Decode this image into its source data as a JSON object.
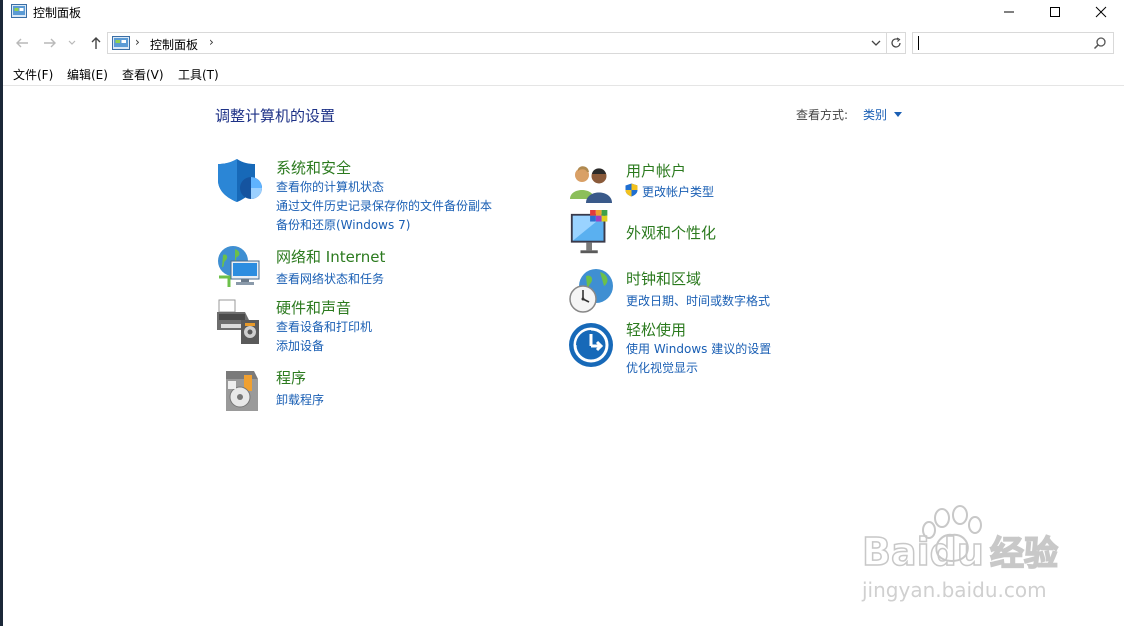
{
  "window": {
    "title": "控制面板"
  },
  "address_bar": {
    "path": "控制面板",
    "separator": "›"
  },
  "search": {
    "value": ""
  },
  "menu": [
    "文件(F)",
    "编辑(E)",
    "查看(V)",
    "工具(T)"
  ],
  "page": {
    "title": "调整计算机的设置",
    "view_label": "查看方式:",
    "view_value": "类别"
  },
  "categories": {
    "system_security": {
      "title": "系统和安全",
      "links": [
        "查看你的计算机状态",
        "通过文件历史记录保存你的文件备份副本",
        "备份和还原(Windows 7)"
      ]
    },
    "network": {
      "title": "网络和 Internet",
      "links": [
        "查看网络状态和任务"
      ]
    },
    "hardware": {
      "title": "硬件和声音",
      "links": [
        "查看设备和打印机",
        "添加设备"
      ]
    },
    "programs": {
      "title": "程序",
      "links": [
        "卸载程序"
      ]
    },
    "user_accounts": {
      "title": "用户帐户",
      "links": [
        "更改帐户类型"
      ]
    },
    "appearance": {
      "title": "外观和个性化",
      "links": []
    },
    "clock_region": {
      "title": "时钟和区域",
      "links": [
        "更改日期、时间或数字格式"
      ]
    },
    "ease": {
      "title": "轻松使用",
      "links": [
        "使用 Windows 建议的设置",
        "优化视觉显示"
      ]
    }
  },
  "watermark": {
    "brand": "Baidu",
    "cn": "经验",
    "url": "jingyan.baidu.com"
  },
  "icons": {
    "title": "control-panel-icon",
    "back": "arrow-left-icon",
    "forward": "arrow-right-icon",
    "up": "arrow-up-icon",
    "refresh": "refresh-icon",
    "search": "search-icon"
  },
  "colors": {
    "category_title": "#2b7a1e",
    "link": "#1a5fb4",
    "page_title": "#1e3287"
  }
}
